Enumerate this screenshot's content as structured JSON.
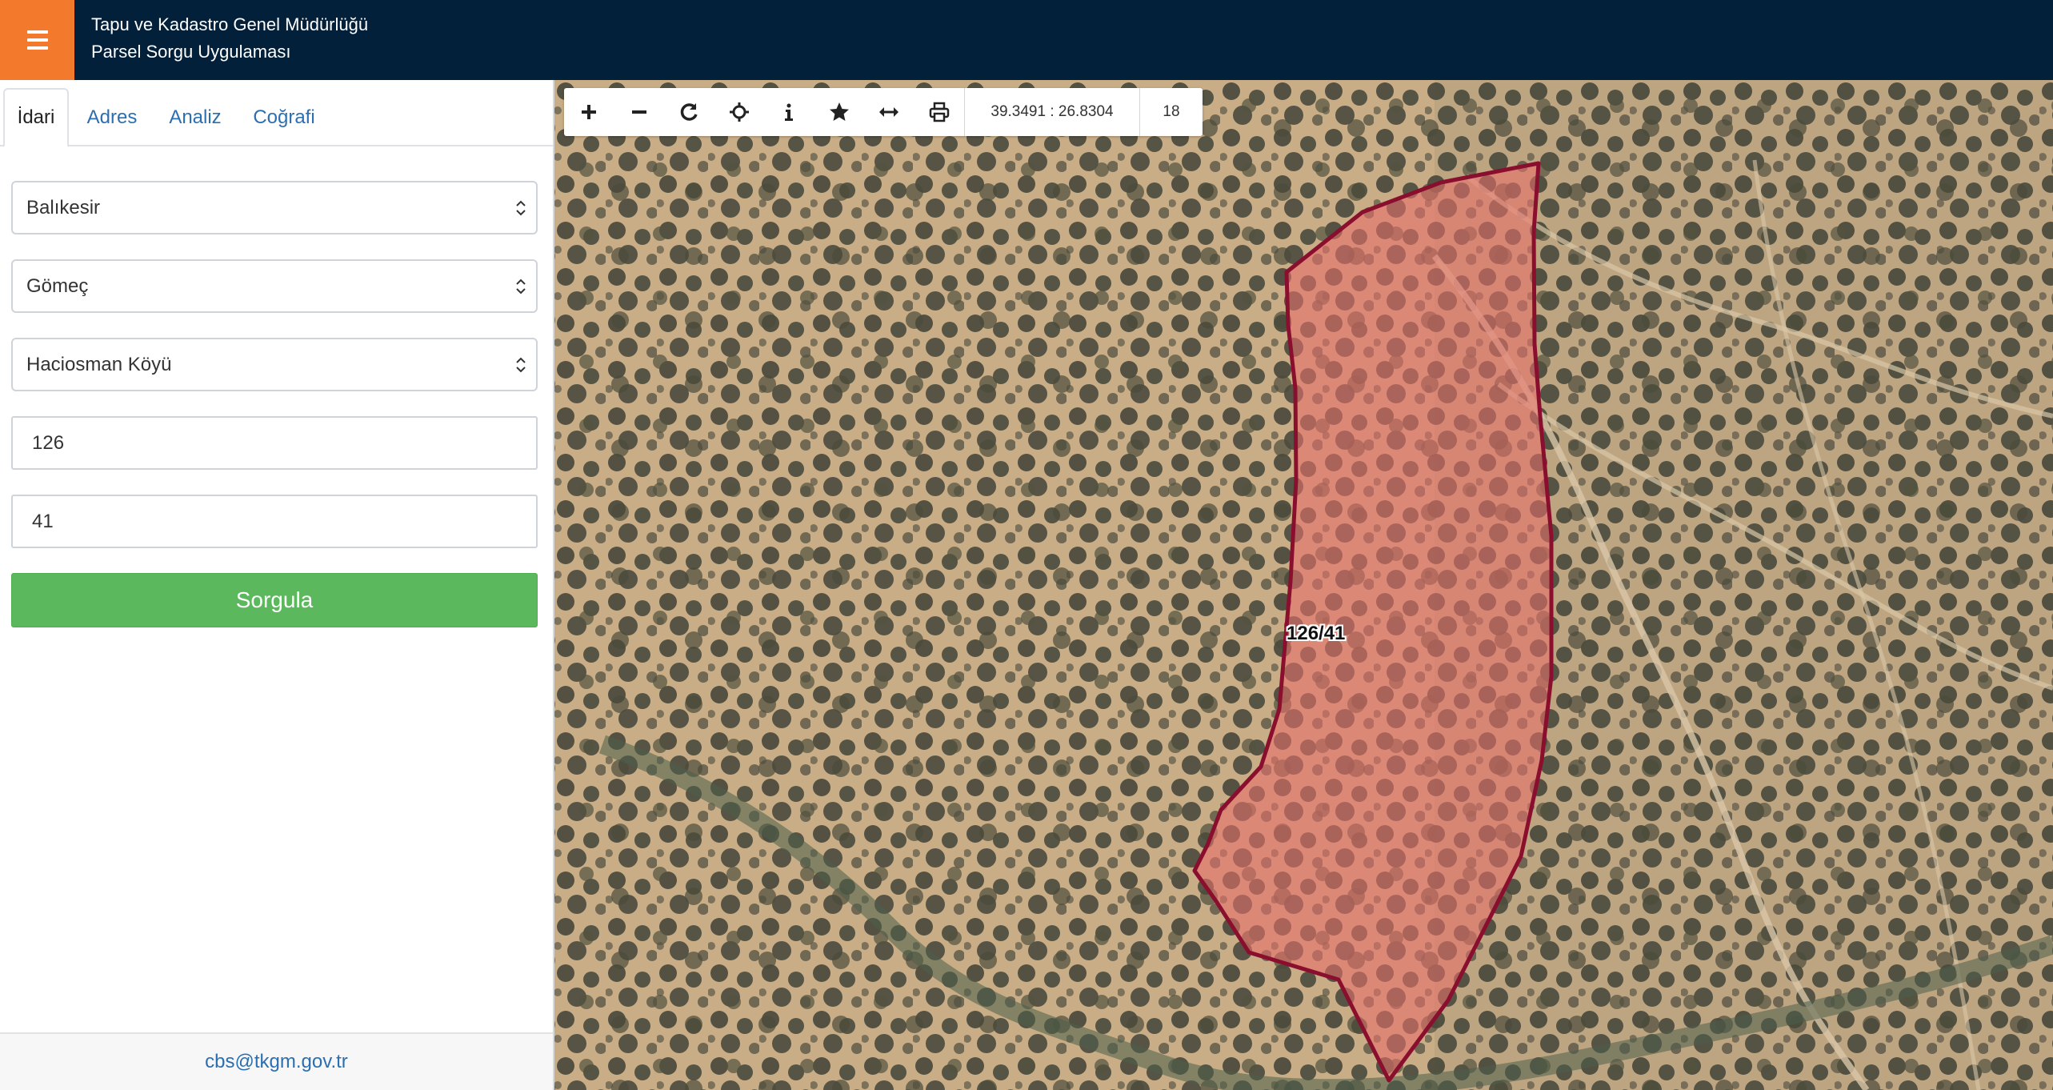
{
  "header": {
    "title_line1": "Tapu ve Kadastro Genel Müdürlüğü",
    "title_line2": "Parsel Sorgu Uygulaması",
    "menu_icon": "hamburger-icon",
    "colors": {
      "header_bg": "#03203a",
      "menu_bg": "#f37a2d"
    }
  },
  "sidebar": {
    "tabs": [
      {
        "label": "İdari",
        "active": true
      },
      {
        "label": "Adres",
        "active": false
      },
      {
        "label": "Analiz",
        "active": false
      },
      {
        "label": "Coğrafi",
        "active": false
      }
    ],
    "form": {
      "province": "Balıkesir",
      "district": "Gömeç",
      "neighborhood": "Haciosman Köyü",
      "block_no": "126",
      "parcel_no": "41"
    },
    "submit_label": "Sorgula",
    "footer_email": "cbs@tkgm.gov.tr",
    "colors": {
      "submit": "#5cb85c",
      "link": "#2c6fb0"
    }
  },
  "map": {
    "toolbar": {
      "tools": [
        "zoom-in-icon",
        "zoom-out-icon",
        "refresh-icon",
        "locate-icon",
        "info-icon",
        "star-icon",
        "measure-icon",
        "print-icon"
      ],
      "coordinates": "39.3491 : 26.8304",
      "zoom_level": "18"
    },
    "parcel_label": "126/41",
    "colors": {
      "parcel_fill": "#e8706a",
      "parcel_stroke": "#8a0f2e"
    }
  }
}
